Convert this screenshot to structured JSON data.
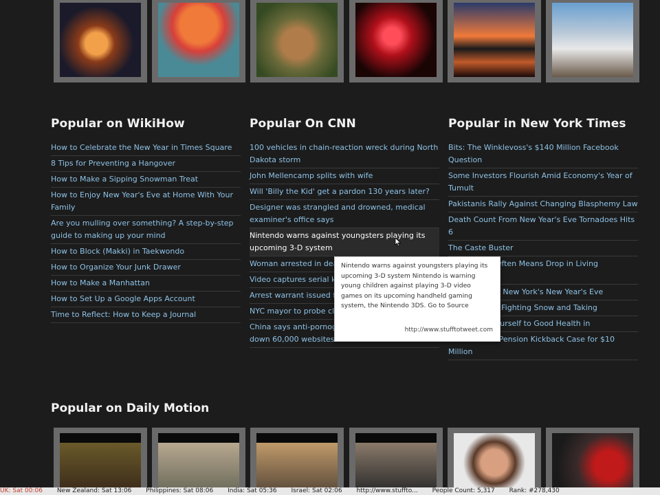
{
  "columns": [
    {
      "title": "Popular on WikiHow",
      "items": [
        "How to Celebrate the New Year in Times Square",
        "8 Tips for Preventing a Hangover",
        "How to Make a Sipping Snowman Treat",
        "How to Enjoy New Year's Eve at Home With Your Family",
        "Are you mulling over something? A step-by-step guide to making up your mind",
        "How to Block (Makki) in Taekwondo",
        "How to Organize Your Junk Drawer",
        "How to Make a Manhattan",
        "How to Set Up a Google Apps Account",
        "Time to Reflect: How to Keep a Journal"
      ]
    },
    {
      "title": "Popular On CNN",
      "items": [
        "100 vehicles in chain-reaction wreck during North Dakota storm",
        "John Mellencamp splits with wife",
        "Will 'Billy the Kid' get a pardon 130 years later?",
        "Designer was strangled and drowned, medical examiner's office says",
        "Nintendo warns against youngsters playing its upcoming 3-D system",
        "Woman arrested in deat",
        "Video captures serial kil",
        "Arrest warrant issued fo punching man",
        "NYC mayor to probe clai cleanup",
        "China says anti-pornography campaign shut down 60,000 websites"
      ]
    },
    {
      "title": "Popular in New York Times",
      "items": [
        "Bits: The Winklevoss's $140 Million Facebook Question",
        "Some Investors Flourish Amid Economy's Year of Tumult",
        "Pakistanis Rally Against Changing Blasphemy Law",
        "Death Count From New Year's Eve Tornadoes Hits 6",
        "The Caste Buster",
        "Career Shift Often Means Drop in Living Standards",
        "Cit... Guide to New York's New Year's Eve",
        "...ation Chief, Fighting Snow and Taking",
        "...centivize Yourself to Good Health in",
        "...ner Settles Pension Kickback Case for $10 Million"
      ]
    }
  ],
  "dailymotion_title": "Popular on Daily Motion",
  "tooltip": {
    "text": "Nintendo warns against youngsters playing its upcoming 3-D system Nintendo is warning young children against playing 3-D video games on its upcoming handheld gaming system, the Nintendo 3DS. Go to Source",
    "source": "http://www.stufftotweet.com"
  },
  "ticker": [
    "UK: Sat 00:06",
    "New Zealand: Sat 13:06",
    "Philippines: Sat 08:06",
    "India: Sat 05:36",
    "Israel: Sat 02:06",
    "http://www.stuffto...",
    "People Count: 5,317",
    "Rank: #278,430"
  ]
}
